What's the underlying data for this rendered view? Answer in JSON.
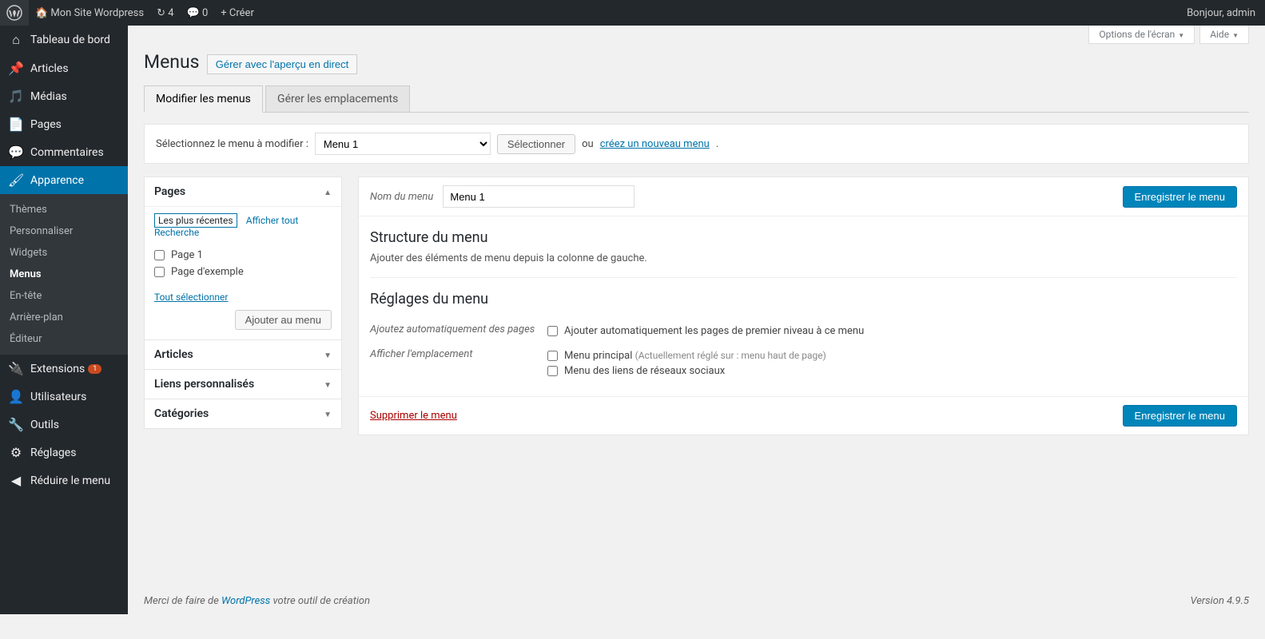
{
  "topbar": {
    "site_name": "Mon Site Wordpress",
    "updates": "4",
    "comments": "0",
    "create": "Créer",
    "greeting": "Bonjour, admin"
  },
  "sidebar": {
    "dashboard": "Tableau de bord",
    "posts": "Articles",
    "media": "Médias",
    "pages": "Pages",
    "comments": "Commentaires",
    "appearance": "Apparence",
    "appearance_sub": {
      "themes": "Thèmes",
      "customize": "Personnaliser",
      "widgets": "Widgets",
      "menus": "Menus",
      "header": "En-tête",
      "background": "Arrière-plan",
      "editor": "Éditeur"
    },
    "plugins": "Extensions",
    "plugins_badge": "1",
    "users": "Utilisateurs",
    "tools": "Outils",
    "settings": "Réglages",
    "collapse": "Réduire le menu"
  },
  "screen": {
    "options": "Options de l'écran",
    "help": "Aide"
  },
  "page": {
    "title": "Menus",
    "live_preview": "Gérer avec l'aperçu en direct"
  },
  "tabs": {
    "edit": "Modifier les menus",
    "locations": "Gérer les emplacements"
  },
  "select_row": {
    "label": "Sélectionnez le menu à modifier :",
    "selected": "Menu 1",
    "button": "Sélectionner",
    "or": "ou",
    "create_link": "créez un nouveau menu"
  },
  "metabox": {
    "pages": {
      "title": "Pages",
      "tab_recent": "Les plus récentes",
      "tab_all": "Afficher tout",
      "tab_search": "Recherche",
      "items": [
        "Page 1",
        "Page d'exemple"
      ],
      "select_all": "Tout sélectionner",
      "add_btn": "Ajouter au menu"
    },
    "posts": "Articles",
    "links": "Liens personnalisés",
    "cats": "Catégories"
  },
  "menu_edit": {
    "name_label": "Nom du menu",
    "name_value": "Menu 1",
    "save_btn": "Enregistrer le menu",
    "structure_h": "Structure du menu",
    "structure_desc": "Ajouter des éléments de menu depuis la colonne de gauche.",
    "settings_h": "Réglages du menu",
    "auto_label": "Ajoutez automatiquement des pages",
    "auto_opt": "Ajouter automatiquement les pages de premier niveau à ce menu",
    "loc_label": "Afficher l'emplacement",
    "loc1": "Menu principal",
    "loc1_note": "(Actuellement réglé sur : menu haut de page)",
    "loc2": "Menu des liens de réseaux sociaux",
    "delete": "Supprimer le menu"
  },
  "footer": {
    "thanks_pre": "Merci de faire de ",
    "wp": "WordPress",
    "thanks_post": " votre outil de création",
    "version": "Version 4.9.5"
  }
}
